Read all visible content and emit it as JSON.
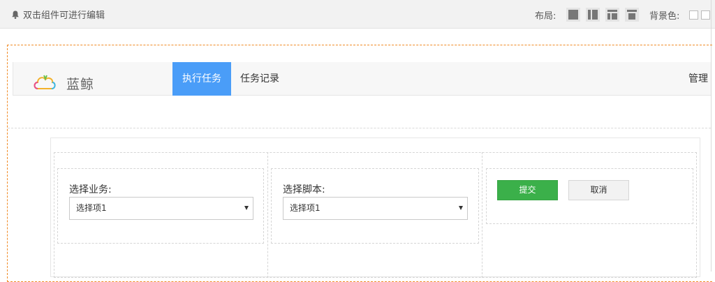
{
  "toolbar": {
    "hint": "双击组件可进行编辑",
    "layout_label": "布局:",
    "layout_options": [
      "full-block-icon",
      "sidebar-left-icon",
      "header-split-icon",
      "header-top-icon"
    ],
    "bg_label": "背景色:"
  },
  "header": {
    "logo_text": "蓝鲸",
    "tabs": [
      {
        "label": "执行任务",
        "active": true
      },
      {
        "label": "任务记录",
        "active": false
      }
    ],
    "right_link": "管理"
  },
  "form": {
    "business": {
      "label": "选择业务:",
      "selected": "选择项1"
    },
    "script": {
      "label": "选择脚本:",
      "selected": "选择项1"
    },
    "submit_label": "提交",
    "cancel_label": "取消"
  },
  "colors": {
    "accent": "#4a9df8",
    "submit": "#3bb04a",
    "canvas_border": "#f08a24"
  }
}
